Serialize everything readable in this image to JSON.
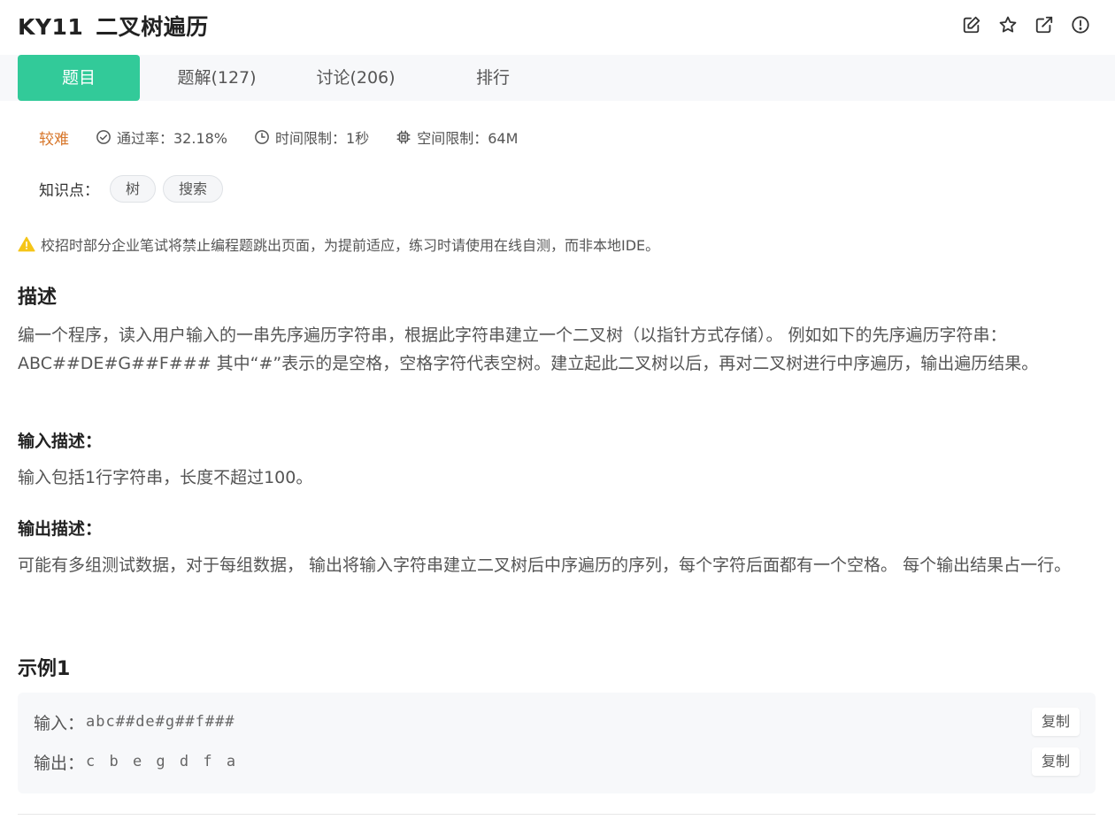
{
  "header": {
    "code": "KY11",
    "title": "二叉树遍历",
    "icons": [
      "edit-icon",
      "star-icon",
      "share-icon",
      "report-icon"
    ]
  },
  "tabs": [
    {
      "label": "题目",
      "active": true
    },
    {
      "label": "题解(127)",
      "active": false
    },
    {
      "label": "讨论(206)",
      "active": false
    },
    {
      "label": "排行",
      "active": false
    }
  ],
  "meta": {
    "difficulty": "较难",
    "pass_rate": "通过率：32.18%",
    "time_limit": "时间限制：1秒",
    "memory_limit": "空间限制：64M"
  },
  "knowledge": {
    "label": "知识点：",
    "tags": [
      "树",
      "搜索"
    ]
  },
  "notice": "校招时部分企业笔试将禁止编程题跳出页面，为提前适应，练习时请使用在线自测，而非本地IDE。",
  "description": {
    "title": "描述",
    "text": "编一个程序，读入用户输入的一串先序遍历字符串，根据此字符串建立一个二叉树（以指针方式存储）。 例如如下的先序遍历字符串： ABC##DE#G##F### 其中“#”表示的是空格，空格字符代表空树。建立起此二叉树以后，再对二叉树进行中序遍历，输出遍历结果。"
  },
  "input_desc": {
    "title": "输入描述：",
    "text": "输入包括1行字符串，长度不超过100。"
  },
  "output_desc": {
    "title": "输出描述：",
    "text": "可能有多组测试数据，对于每组数据， 输出将输入字符串建立二叉树后中序遍历的序列，每个字符后面都有一个空格。 每个输出结果占一行。"
  },
  "example": {
    "title": "示例1",
    "input_label": "输入：",
    "input_value": "abc##de#g##f###",
    "output_label": "输出：",
    "output_value": "c b e g d f a",
    "copy_label": "复制"
  },
  "colors": {
    "accent": "#32ca99",
    "difficulty": "#d7762a",
    "warning": "#f5c518"
  }
}
